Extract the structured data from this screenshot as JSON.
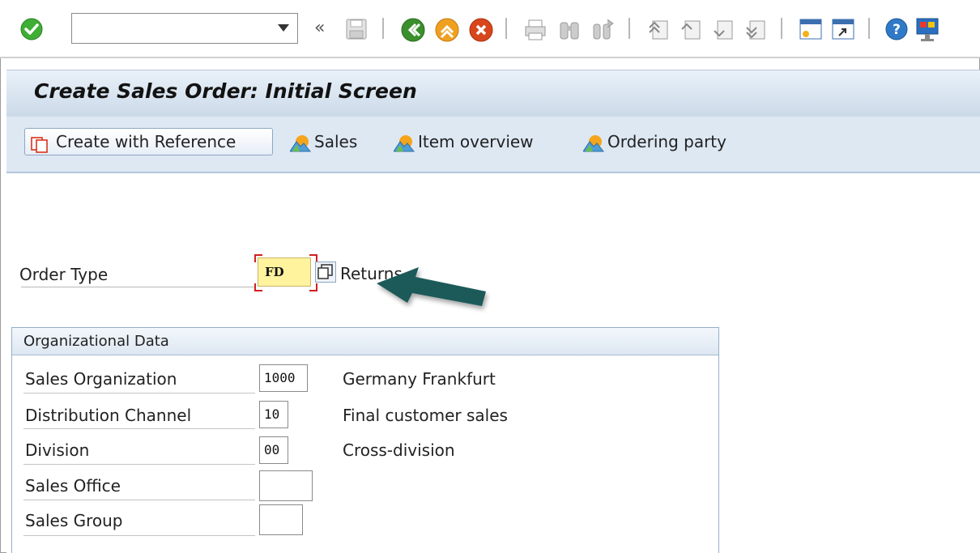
{
  "toolbar": {
    "command_field_value": "",
    "icons": [
      "enter-check-icon",
      "command-field",
      "dropdown-icon",
      "double-chevron-left-icon",
      "save-icon",
      "back-icon",
      "exit-icon",
      "cancel-icon",
      "print-icon",
      "find-icon",
      "find-next-icon",
      "first-page-icon",
      "previous-page-icon",
      "next-page-icon",
      "last-page-icon",
      "new-session-icon",
      "shortcut-icon",
      "help-icon",
      "customize-layout-icon"
    ]
  },
  "title": "Create Sales Order: Initial Screen",
  "app_toolbar": {
    "create_with_reference": "Create with Reference",
    "sales": "Sales",
    "item_overview": "Item overview",
    "ordering_party": "Ordering party"
  },
  "order_type": {
    "label": "Order Type",
    "value": "FD",
    "description": "Returns"
  },
  "org_data": {
    "title": "Organizational Data",
    "rows": [
      {
        "label": "Sales Organization",
        "value": "1000",
        "description": "Germany Frankfurt"
      },
      {
        "label": "Distribution Channel",
        "value": "10",
        "description": "Final customer sales"
      },
      {
        "label": "Division",
        "value": "00",
        "description": "Cross-division"
      },
      {
        "label": "Sales Office",
        "value": "",
        "description": ""
      },
      {
        "label": "Sales Group",
        "value": "",
        "description": ""
      }
    ]
  },
  "colors": {
    "title_bar": "#cbd9e8",
    "app_toolbar": "#dde8f3",
    "required_field": "#fff39e",
    "focus_corner": "#d02020",
    "arrow": "#1f5a5a"
  }
}
